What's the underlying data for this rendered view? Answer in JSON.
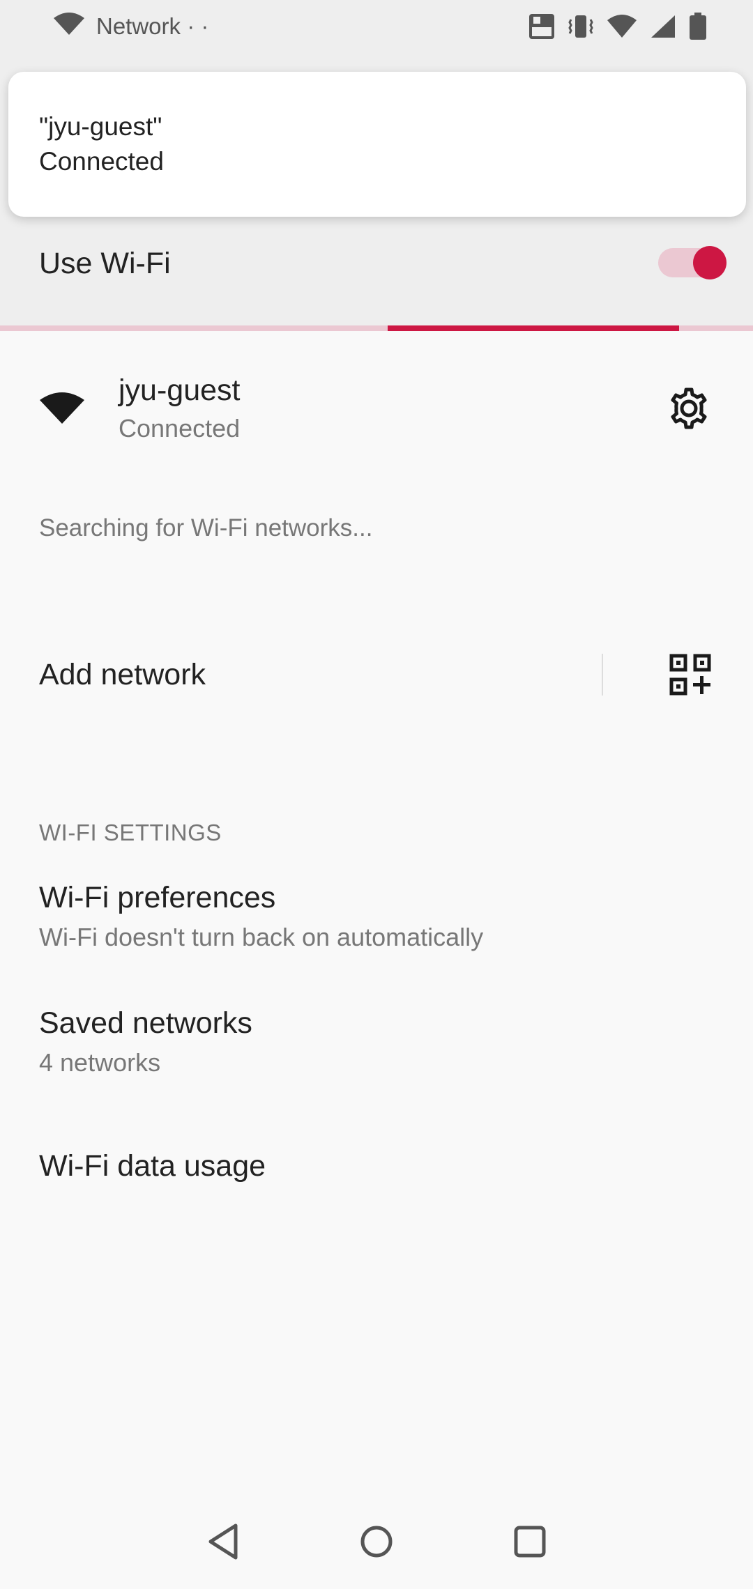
{
  "status_bar": {
    "network_text": "Network · ·",
    "icons": [
      "wifi-icon",
      "volte-icon",
      "vibrate-icon",
      "wifi-signal-icon",
      "cell-signal-icon",
      "battery-icon"
    ]
  },
  "notification": {
    "title": "\"jyu-guest\"",
    "text": "Connected"
  },
  "use_wifi": {
    "label": "Use Wi-Fi",
    "enabled": true
  },
  "connected_network": {
    "name": "jyu-guest",
    "status": "Connected"
  },
  "searching_text": "Searching for Wi-Fi networks...",
  "add_network": {
    "label": "Add network"
  },
  "wifi_settings": {
    "section_header": "WI-FI SETTINGS",
    "items": [
      {
        "title": "Wi-Fi preferences",
        "subtitle": "Wi-Fi doesn't turn back on automatically"
      },
      {
        "title": "Saved networks",
        "subtitle": "4 networks"
      },
      {
        "title": "Wi-Fi data usage"
      }
    ]
  },
  "colors": {
    "accent": "#cd1743",
    "accent_light": "#ebc8d2",
    "background": "#f9f9f9",
    "header_background": "#eeeeee"
  }
}
